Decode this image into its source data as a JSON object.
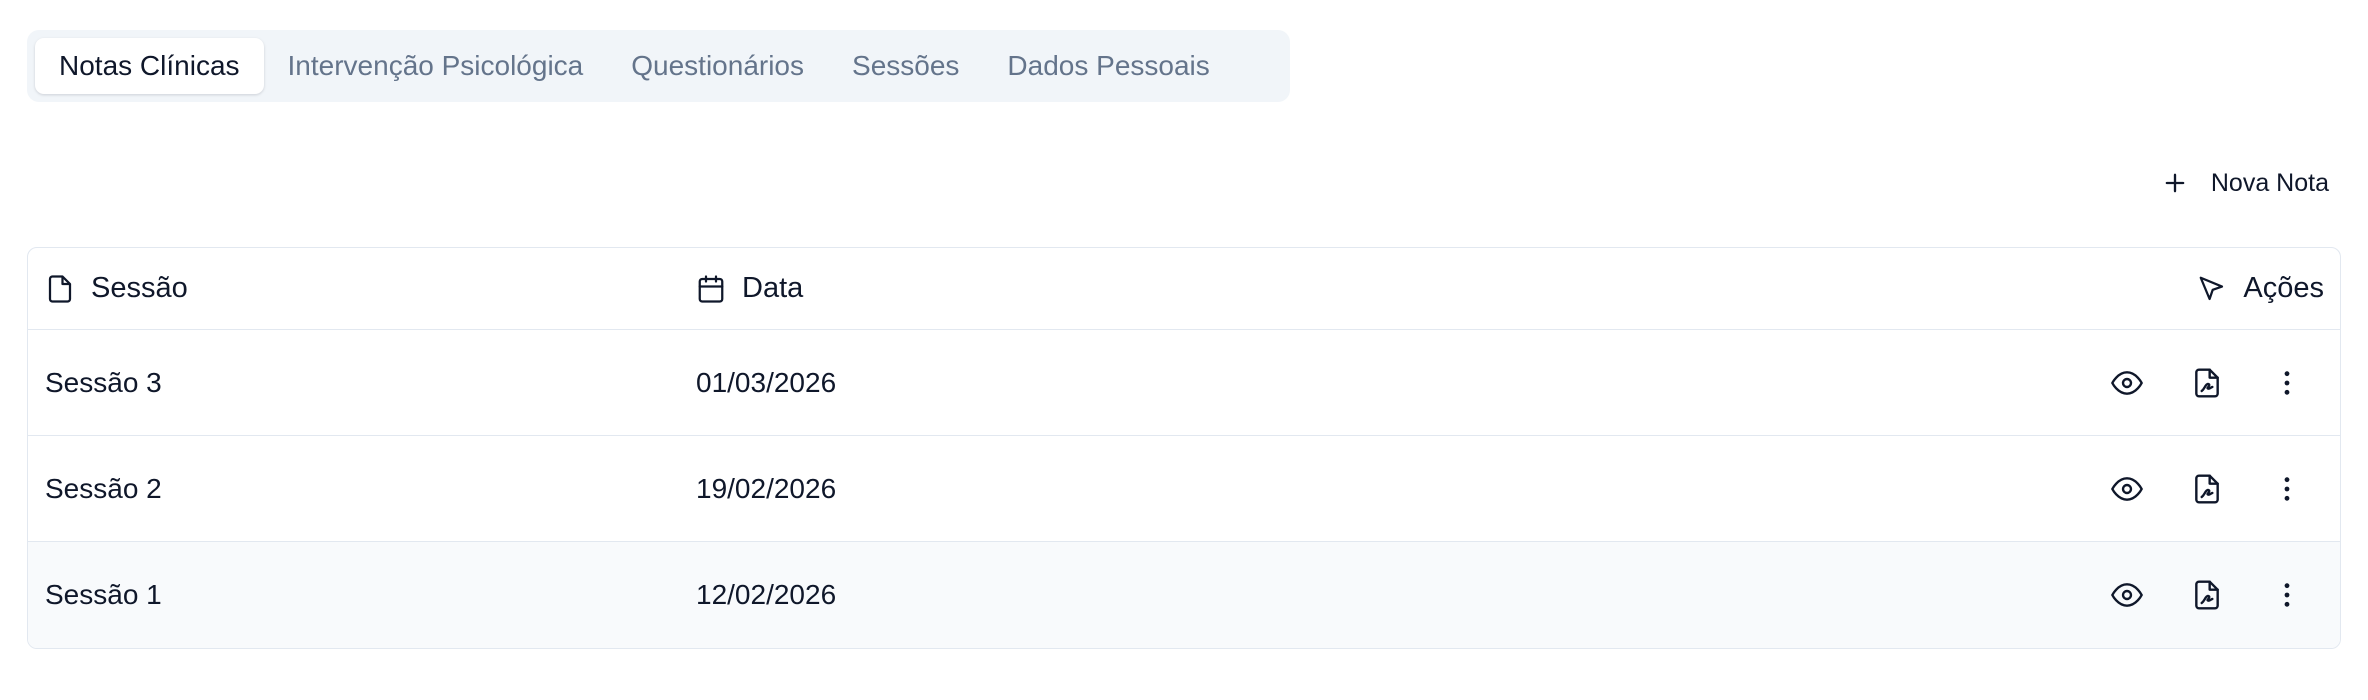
{
  "tabs": [
    {
      "label": "Notas Clínicas",
      "active": true
    },
    {
      "label": "Intervenção Psicológica",
      "active": false
    },
    {
      "label": "Questionários",
      "active": false
    },
    {
      "label": "Sessões",
      "active": false
    },
    {
      "label": "Dados Pessoais",
      "active": false
    }
  ],
  "toolbar": {
    "new_note_label": "Nova Nota",
    "new_note_icon": "plus-icon"
  },
  "table": {
    "headers": {
      "session": {
        "label": "Sessão",
        "icon": "file-icon"
      },
      "date": {
        "label": "Data",
        "icon": "calendar-icon"
      },
      "actions": {
        "label": "Ações",
        "icon": "cursor-pointer-icon"
      }
    },
    "rows": [
      {
        "session": "Sessão 3",
        "date": "01/03/2026"
      },
      {
        "session": "Sessão 2",
        "date": "19/02/2026"
      },
      {
        "session": "Sessão 1",
        "date": "12/02/2026"
      }
    ],
    "row_actions": [
      "eye-icon",
      "file-signature-icon",
      "more-vertical-icon"
    ]
  },
  "colors": {
    "tab_bar_bg": "#f1f5f9",
    "tab_inactive_text": "#64748b",
    "text": "#0f172a",
    "border": "#e2e8f0",
    "hover_row_bg": "#f8fafc"
  }
}
